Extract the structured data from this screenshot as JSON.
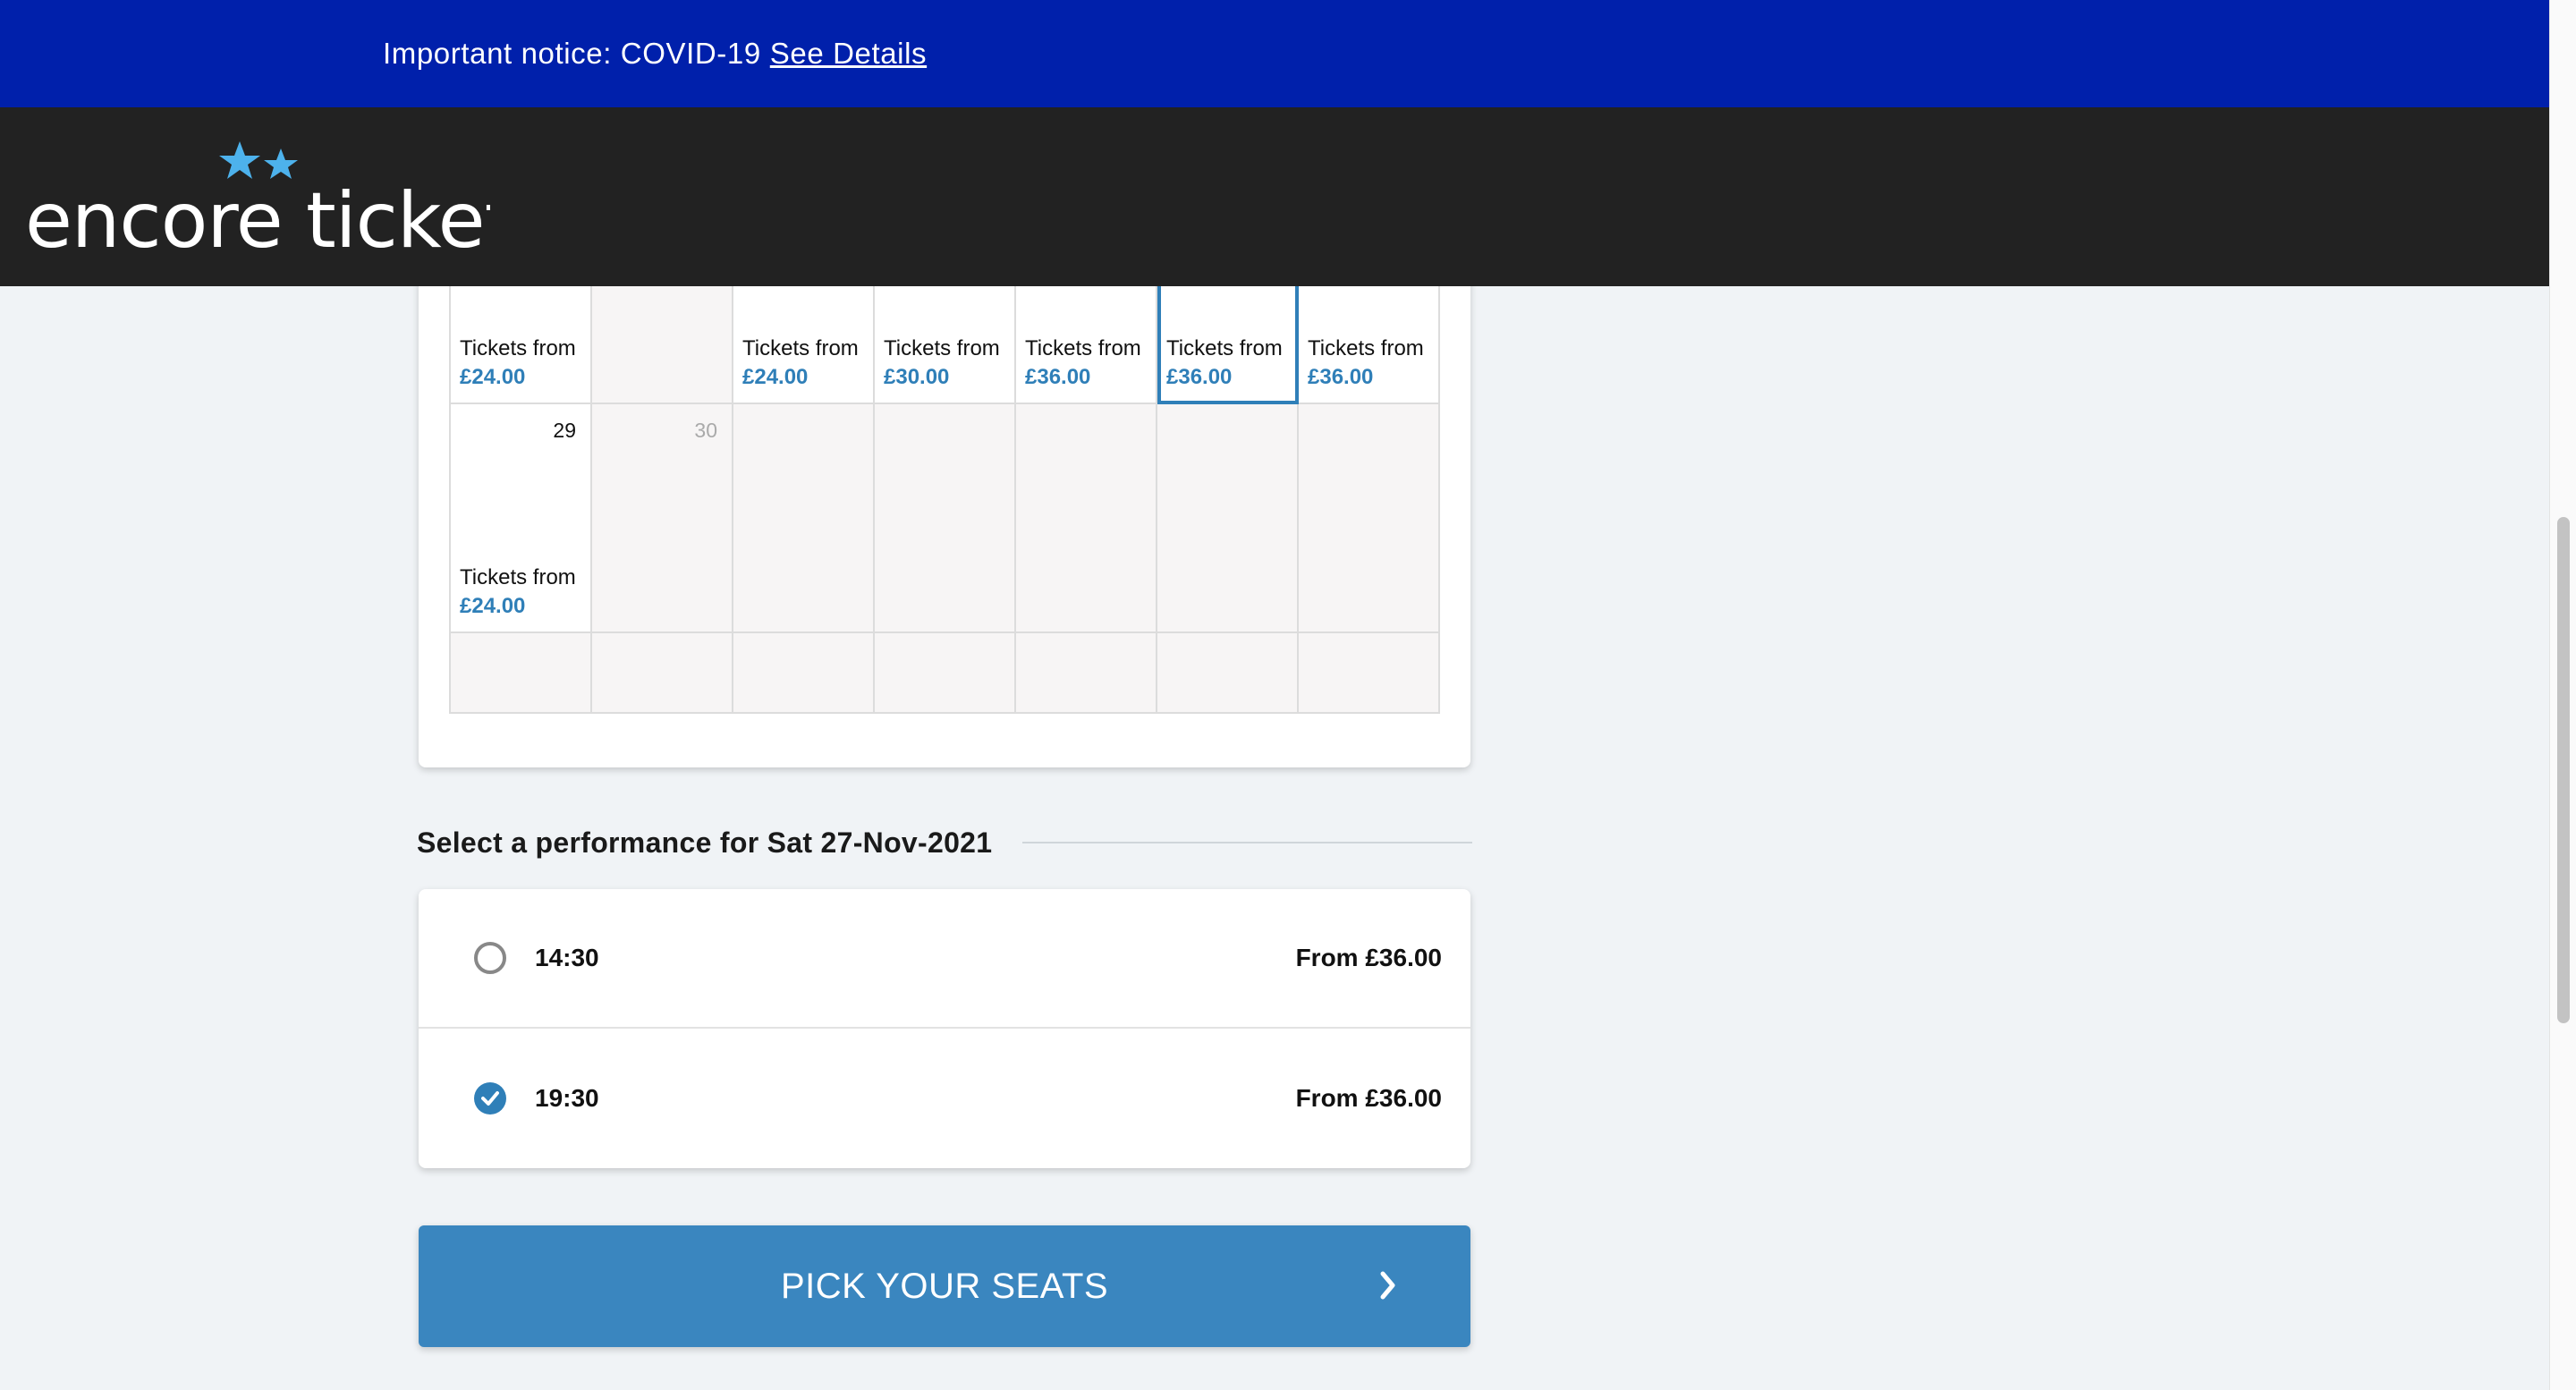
{
  "notice": {
    "text": "Important notice: COVID-19",
    "link": "See Details"
  },
  "brand": {
    "logo_text": "encore tickets"
  },
  "calendar": {
    "tickets_from_label": "Tickets from",
    "row1": [
      {
        "price": "£24.00",
        "available": true
      },
      {
        "price": "",
        "available": false
      },
      {
        "price": "£24.00",
        "available": true
      },
      {
        "price": "£30.00",
        "available": true
      },
      {
        "price": "£36.00",
        "available": true
      },
      {
        "price": "£36.00",
        "available": true,
        "selected": true
      },
      {
        "price": "£36.00",
        "available": true
      }
    ],
    "row2": [
      {
        "day": "29",
        "price": "£24.00",
        "available": true
      },
      {
        "day": "30",
        "price": "",
        "available": false
      }
    ]
  },
  "performance": {
    "heading": "Select a performance for Sat 27-Nov-2021",
    "options": [
      {
        "time": "14:30",
        "price": "From £36.00",
        "selected": false
      },
      {
        "time": "19:30",
        "price": "From £36.00",
        "selected": true
      }
    ]
  },
  "cta": {
    "label": "PICK YOUR SEATS"
  },
  "colors": {
    "notice_bg": "#0020ab",
    "header_bg": "#222222",
    "accent": "#3a86bf",
    "price_text": "#2f7fb8",
    "page_bg": "#f0f3f6"
  }
}
